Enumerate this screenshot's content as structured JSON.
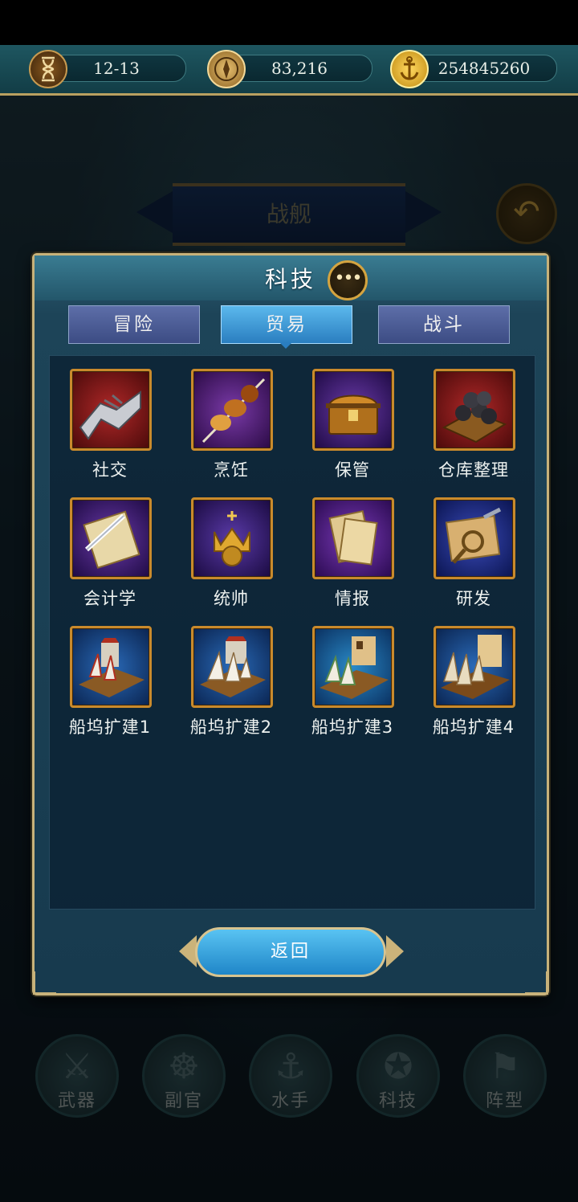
{
  "resources": {
    "date": "12-13",
    "compass_value": "83,216",
    "gold_value": "254845260"
  },
  "background": {
    "banner_title": "战舰"
  },
  "modal": {
    "title": "科技",
    "tabs": [
      "冒险",
      "贸易",
      "战斗"
    ],
    "active_tab_index": 1,
    "skills": [
      {
        "label": "社交",
        "icon": "handshake-icon"
      },
      {
        "label": "烹饪",
        "icon": "skewer-icon"
      },
      {
        "label": "保管",
        "icon": "treasure-chest-icon"
      },
      {
        "label": "仓库整理",
        "icon": "cannonballs-crate-icon"
      },
      {
        "label": "会计学",
        "icon": "scroll-quill-icon"
      },
      {
        "label": "统帅",
        "icon": "crown-emblem-icon"
      },
      {
        "label": "情报",
        "icon": "papers-icon"
      },
      {
        "label": "研发",
        "icon": "magnifier-map-icon"
      },
      {
        "label": "船坞扩建1",
        "icon": "dockyard-1-icon"
      },
      {
        "label": "船坞扩建2",
        "icon": "dockyard-2-icon"
      },
      {
        "label": "船坞扩建3",
        "icon": "dockyard-3-icon"
      },
      {
        "label": "船坞扩建4",
        "icon": "dockyard-4-icon"
      }
    ],
    "return_label": "返回"
  },
  "bottom_nav": [
    {
      "label": "武器",
      "icon": "sword-icon"
    },
    {
      "label": "副官",
      "icon": "helm-wheel-icon"
    },
    {
      "label": "水手",
      "icon": "hook-icon"
    },
    {
      "label": "科技",
      "icon": "compass-icon"
    },
    {
      "label": "阵型",
      "icon": "flag-icon"
    }
  ],
  "colors": {
    "active_tab": "#2a7ec0",
    "inactive_tab": "#3c4c84",
    "icon_border": "#c98a2c",
    "modal_border": "#c8b27a"
  }
}
